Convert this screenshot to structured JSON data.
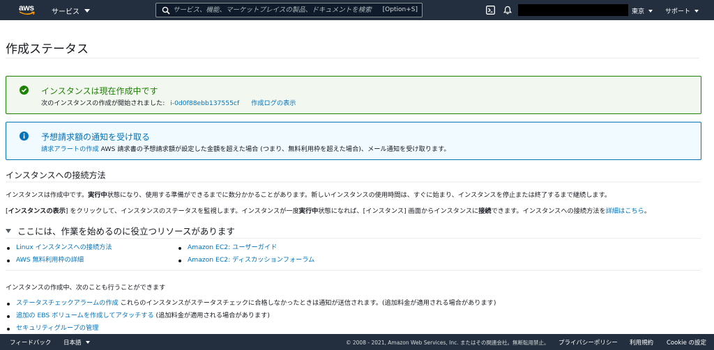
{
  "topnav": {
    "logo_text": "aws",
    "services_label": "サービス",
    "search_placeholder": "サービス、機能、マーケットプレイスの製品、ドキュメントを検索",
    "search_shortcut": "[Option+S]",
    "region_label": "東京",
    "support_label": "サポート",
    "icons": [
      "terminal-icon",
      "bell-icon"
    ]
  },
  "page": {
    "title": "作成ステータス"
  },
  "success_alert": {
    "header": "インスタンスは現在作成中です",
    "body_prefix": "次のインスタンスの作成が開始されました:",
    "instance_id": "i-0d0f88ebb137555cf",
    "log_link": "作成ログの表示"
  },
  "info_alert": {
    "header": "予想請求額の通知を受け取る",
    "link": "請求アラートの作成",
    "body_rest": " AWS 請求書の予想請求額が設定した金額を超えた場合 (つまり、無料利用枠を超えた場合)、メール通知を受け取ります。"
  },
  "connect_section": {
    "title": "インスタンスへの接続方法",
    "p1_a": "インスタンスは作成中です。",
    "p1_b": "実行中",
    "p1_c": "状態になり、使用する準備ができるまでに数分かかることがあります。新しいインスタンスの使用時間は、すぐに始まり、インスタンスを停止または終了するまで継続します。",
    "p2_a": "[",
    "p2_b": "インスタンスの表示",
    "p2_c": "] をクリックして、インスタンスのステータスを監視します。インスタンスが一度",
    "p2_d": "実行中",
    "p2_e": "状態になれば、[インスタンス] 画面からインスタンスに",
    "p2_f": "接続",
    "p2_g": "できます。インスタンスへの接続方法を",
    "p2_link": "詳細はこちら",
    "p2_end": "。"
  },
  "resources": {
    "title": "ここには、作業を始めるのに役立つリソースがあります",
    "left": [
      "Linux インスタンスへの接続方法",
      "AWS 無料利用枠の詳細"
    ],
    "right": [
      "Amazon EC2: ユーザーガイド",
      "Amazon EC2: ディスカッションフォーラム"
    ]
  },
  "also": {
    "intro": "インスタンスの作成中、次のことも行うことができます",
    "items": [
      {
        "link": "ステータスチェックアラームの作成",
        "text": " これらのインスタンスがステータスチェックに合格しなかったときは通知が送信されます。(追加料金が適用される場合があります)"
      },
      {
        "link": "追加の EBS ボリュームを作成してアタッチする",
        "text": " (追加料金が適用される場合があります)"
      },
      {
        "link": "セキュリティグループの管理",
        "text": ""
      }
    ]
  },
  "footer": {
    "feedback": "フィードバック",
    "language": "日本語",
    "copyright": "© 2008 - 2021, Amazon Web Services, Inc. またはその関連会社。無断転用禁止。",
    "privacy": "プライバシーポリシー",
    "terms": "利用規約",
    "cookie": "Cookie の設定"
  },
  "colors": {
    "nav_bg": "#232f3e",
    "success": "#1d8102",
    "info": "#0073bb",
    "link": "#0073bb"
  }
}
